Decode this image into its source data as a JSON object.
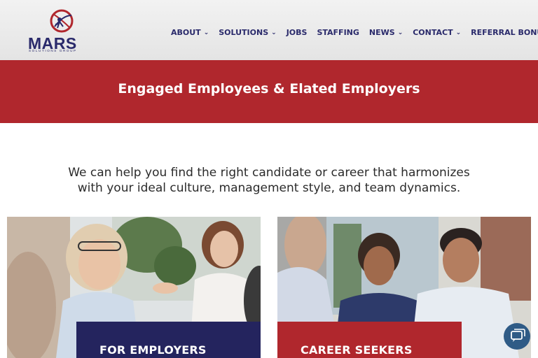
{
  "brand": {
    "name": "MARS",
    "tagline": "SOLUTIONS GROUP",
    "colors": {
      "navy": "#24245e",
      "red": "#b0272d"
    }
  },
  "nav": {
    "items": [
      {
        "label": "ABOUT",
        "dropdown": true
      },
      {
        "label": "SOLUTIONS",
        "dropdown": true
      },
      {
        "label": "JOBS",
        "dropdown": false
      },
      {
        "label": "STAFFING",
        "dropdown": false
      },
      {
        "label": "NEWS",
        "dropdown": true
      },
      {
        "label": "CONTACT",
        "dropdown": true
      },
      {
        "label": "REFERRAL BONUS",
        "dropdown": false
      }
    ]
  },
  "banner": {
    "title": "Engaged Employees & Elated Employers"
  },
  "intro": {
    "line1": "We can help you find the right candidate or career that harmonizes",
    "line2": "with your ideal culture, management style, and team dynamics."
  },
  "cards": [
    {
      "label": "FOR EMPLOYERS",
      "icon": "employers-photo"
    },
    {
      "label": "CAREER SEEKERS",
      "icon": "career-seekers-photo"
    }
  ],
  "chat": {
    "icon": "chat-icon"
  }
}
